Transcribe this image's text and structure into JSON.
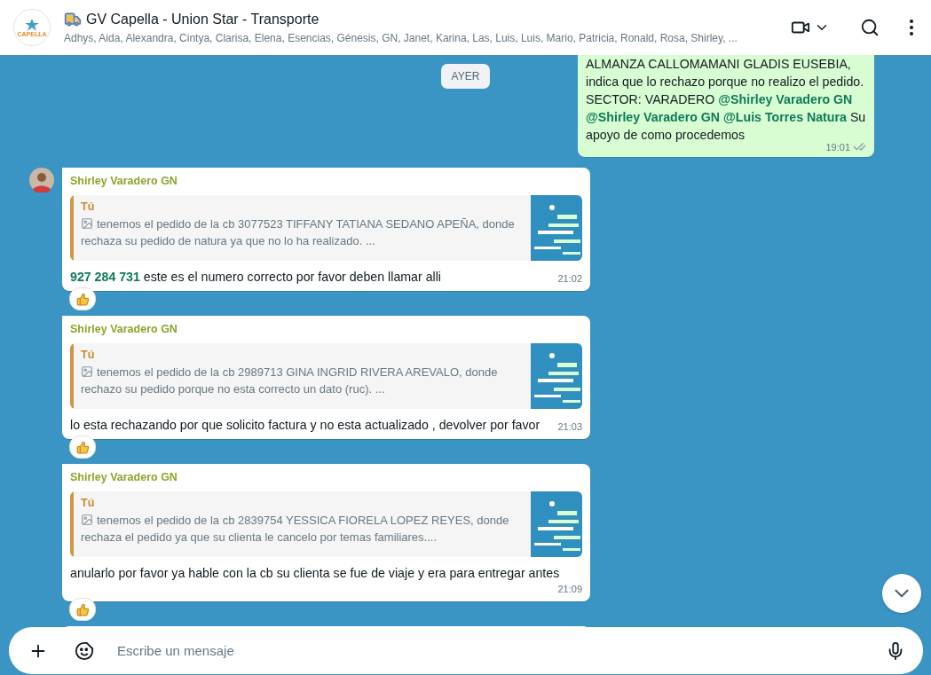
{
  "header": {
    "logo_text": "CAPELLA",
    "title": "GV Capella - Union Star - Transporte",
    "members": "Adhys, Aida, Alexandra, Cintya, Clarisa, Elena, Esencias, Génesis, GN, Janet, Karina, Las, Luis, Luis, Mario, Patricia, Ronald, Rosa, Shirley, ..."
  },
  "date_divider": "AYER",
  "messages": [
    {
      "kind": "outgoing",
      "text": "ALMANZA CALLOMAMANI GLADIS EUSEBIA, indica que lo rechazo porque no realizo el pedido. SECTOR: VARADERO **@Shirley Varadero GN** **@Shirley Varadero GN** **@Luis Torres Natura** Su apoyo de como procedemos",
      "time": "19:01",
      "read": false
    },
    {
      "kind": "incoming",
      "show_avatar": true,
      "sender": "Shirley Varadero GN",
      "quote": {
        "author": "Tú",
        "text": "tenemos el pedido de la cb 3077523 TIFFANY TATIANA SEDANO APEÑA, donde rechaza su pedido de natura ya que no lo ha realizado. ..."
      },
      "text": "**927 284 731** este es el numero correcto por favor deben llamar alli",
      "time": "21:02",
      "reacted": true
    },
    {
      "kind": "incoming",
      "show_avatar": false,
      "sender": "Shirley Varadero GN",
      "quote": {
        "author": "Tú",
        "text": "tenemos el pedido de la cb 2989713 GINA INGRID RIVERA AREVALO, donde rechazo su pedido porque no esta correcto un dato (ruc). ..."
      },
      "text": "lo esta rechazando por que solicito factura y no esta actualizado , devolver por favor",
      "time": "21:03",
      "reacted": true
    },
    {
      "kind": "incoming",
      "show_avatar": false,
      "sender": "Shirley Varadero GN",
      "quote": {
        "author": "Tú",
        "text": "tenemos el pedido de la cb 2839754 YESSICA FIORELA LOPEZ REYES, donde rechaza el pedido ya que su clienta le cancelo por temas familiares...."
      },
      "text": "anularlo por favor ya hable con la cb su clienta se fue de viaje y era para entregar antes",
      "time": "21:09",
      "reacted": true
    }
  ],
  "composer": {
    "placeholder": "Escribe un mensaje"
  }
}
